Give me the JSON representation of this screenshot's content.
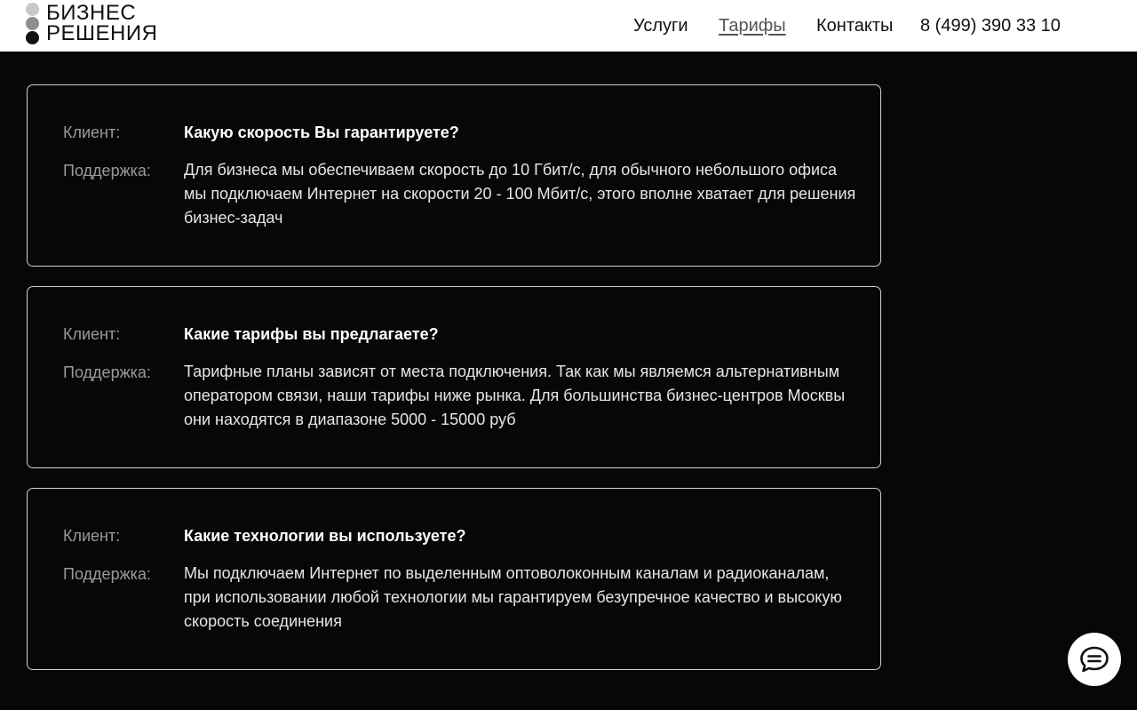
{
  "brand": {
    "line1": "БИЗНЕС",
    "line2": "РЕШЕНИЯ"
  },
  "nav": {
    "items": [
      {
        "label": "Услуги",
        "active": false
      },
      {
        "label": "Тарифы",
        "active": true
      },
      {
        "label": "Контакты",
        "active": false
      }
    ],
    "phone": "8 (499) 390 33 10"
  },
  "faq": [
    {
      "client_label": "Клиент:",
      "question": "Какую скорость Вы гарантируете?",
      "support_label": "Поддержка:",
      "answer": "Для бизнеса мы обеспечиваем скорость до 10 Гбит/с, для обычного небольшого офиса мы подключаем Интернет на скорости 20 - 100 Мбит/с, этого вполне хватает для решения бизнес-задач"
    },
    {
      "client_label": "Клиент:",
      "question": "Какие тарифы вы предлагаете?",
      "support_label": "Поддержка:",
      "answer": "Тарифные планы зависят от места подключения. Так как мы являемся альтернативным оператором связи, наши тарифы ниже рынка. Для большинства бизнес-центров Москвы они находятся в диапазоне 5000 - 15000 руб"
    },
    {
      "client_label": "Клиент:",
      "question": "Какие технологии вы используете?",
      "support_label": "Поддержка:",
      "answer": "Мы подключаем Интернет по выделенным оптоволоконным каналам и радиоканалам, при использовании любой технологии мы гарантируем безупречное качество и высокую скорость соединения"
    }
  ],
  "chat": {
    "icon": "chat-bubble-icon"
  },
  "colors": {
    "background": "#070707",
    "header_bg": "#ffffff",
    "card_border": "#cfcfcf",
    "label_gray": "#9a9a9a"
  }
}
